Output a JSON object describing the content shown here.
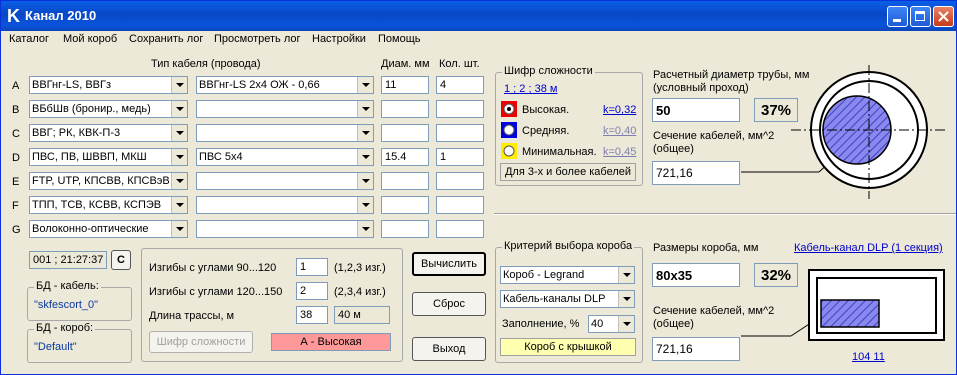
{
  "window": {
    "title": "Канал 2010"
  },
  "menu": [
    "Каталог",
    "Мой короб",
    "Сохранить лог",
    "Просмотреть лог",
    "Настройки",
    "Помощь"
  ],
  "table": {
    "col_cable": "Тип кабеля (провода)",
    "col_diam": "Диам. мм",
    "col_qty": "Кол. шт.",
    "rows": [
      {
        "letter": "A",
        "type": "ВВГнг-LS, ВВГз",
        "model": "ВВГнг-LS 2х4 ОЖ - 0,66",
        "diam": "11",
        "qty": "4"
      },
      {
        "letter": "B",
        "type": "ВБбШв (бронир., медь)",
        "model": "",
        "diam": "",
        "qty": ""
      },
      {
        "letter": "C",
        "type": "ВВГ; РК, КВК-П-3",
        "model": "",
        "diam": "",
        "qty": ""
      },
      {
        "letter": "D",
        "type": "ПВС, ПВ, ШВВП, МКШ",
        "model": "ПВС 5х4",
        "diam": "15.4",
        "qty": "1"
      },
      {
        "letter": "E",
        "type": "FTP, UTP, КПСВВ, КПСВэВ",
        "model": "",
        "diam": "",
        "qty": ""
      },
      {
        "letter": "F",
        "type": "ТПП, ТСВ, КСВВ, КСПЭВ",
        "model": "",
        "diam": "",
        "qty": ""
      },
      {
        "letter": "G",
        "type": "Волоконно-оптические",
        "model": "",
        "diam": "",
        "qty": ""
      }
    ]
  },
  "info": {
    "time": "001 ; 21:27:37",
    "c_button": "C",
    "db_cable_title": "БД - кабель:",
    "db_cable_value": "\"skfescort_0\"",
    "db_box_title": "БД - короб:",
    "db_box_value": "\"Default\""
  },
  "params": {
    "bends_90_label": "Изгибы с углами  90...120",
    "bends_90_value": "1",
    "bends_90_hint": "(1,2,3 изг.)",
    "bends_120_label": "Изгибы с углами 120...150",
    "bends_120_value": "2",
    "bends_120_hint": "(2,3,4 изг.)",
    "length_label": "Длина трассы, м",
    "length_value": "38",
    "length_value2": "40 м",
    "complexity_button": "Шифр сложности",
    "complexity_result": "А - Высокая"
  },
  "actions": {
    "calculate": "Вычислить",
    "reset": "Сброс",
    "exit": "Выход"
  },
  "complexity": {
    "title": "Шифр сложности",
    "code": "1  ;  2  ;  38 м",
    "levels": [
      {
        "label": "Высокая.",
        "k": "k=0,32"
      },
      {
        "label": "Средняя.",
        "k": "k=0,40"
      },
      {
        "label": "Минимальная.",
        "k": "k=0,45"
      }
    ],
    "note": "Для 3-х и более кабелей"
  },
  "pipe": {
    "diam_title": "Расчетный диаметр трубы, мм",
    "diam_sub": "(условный проход)",
    "diam_value": "50",
    "percent": "37%",
    "section_title": "Сечение кабелей, мм^2",
    "section_sub": "(общее)",
    "section_value": "721,16"
  },
  "box_criteria": {
    "title": "Критерий выбора короба",
    "maker": "Короб - Legrand",
    "kind": "Кабель-каналы DLP",
    "fill_label": "Заполнение, %",
    "fill_value": "40",
    "cover": "Короб с крышкой"
  },
  "box": {
    "size_title": "Размеры короба, мм",
    "size_value": "80x35",
    "percent": "32%",
    "section_title": "Сечение кабелей, мм^2",
    "section_sub": "(общее)",
    "section_value": "721,16",
    "link": "Кабель-канал DLP (1 секция)",
    "code": "104 11"
  },
  "colors": {
    "title_bar": "#0a54dc",
    "result_bg": "#ff9999",
    "cover_bg": "#ffffb0",
    "link": "#0000cc"
  }
}
